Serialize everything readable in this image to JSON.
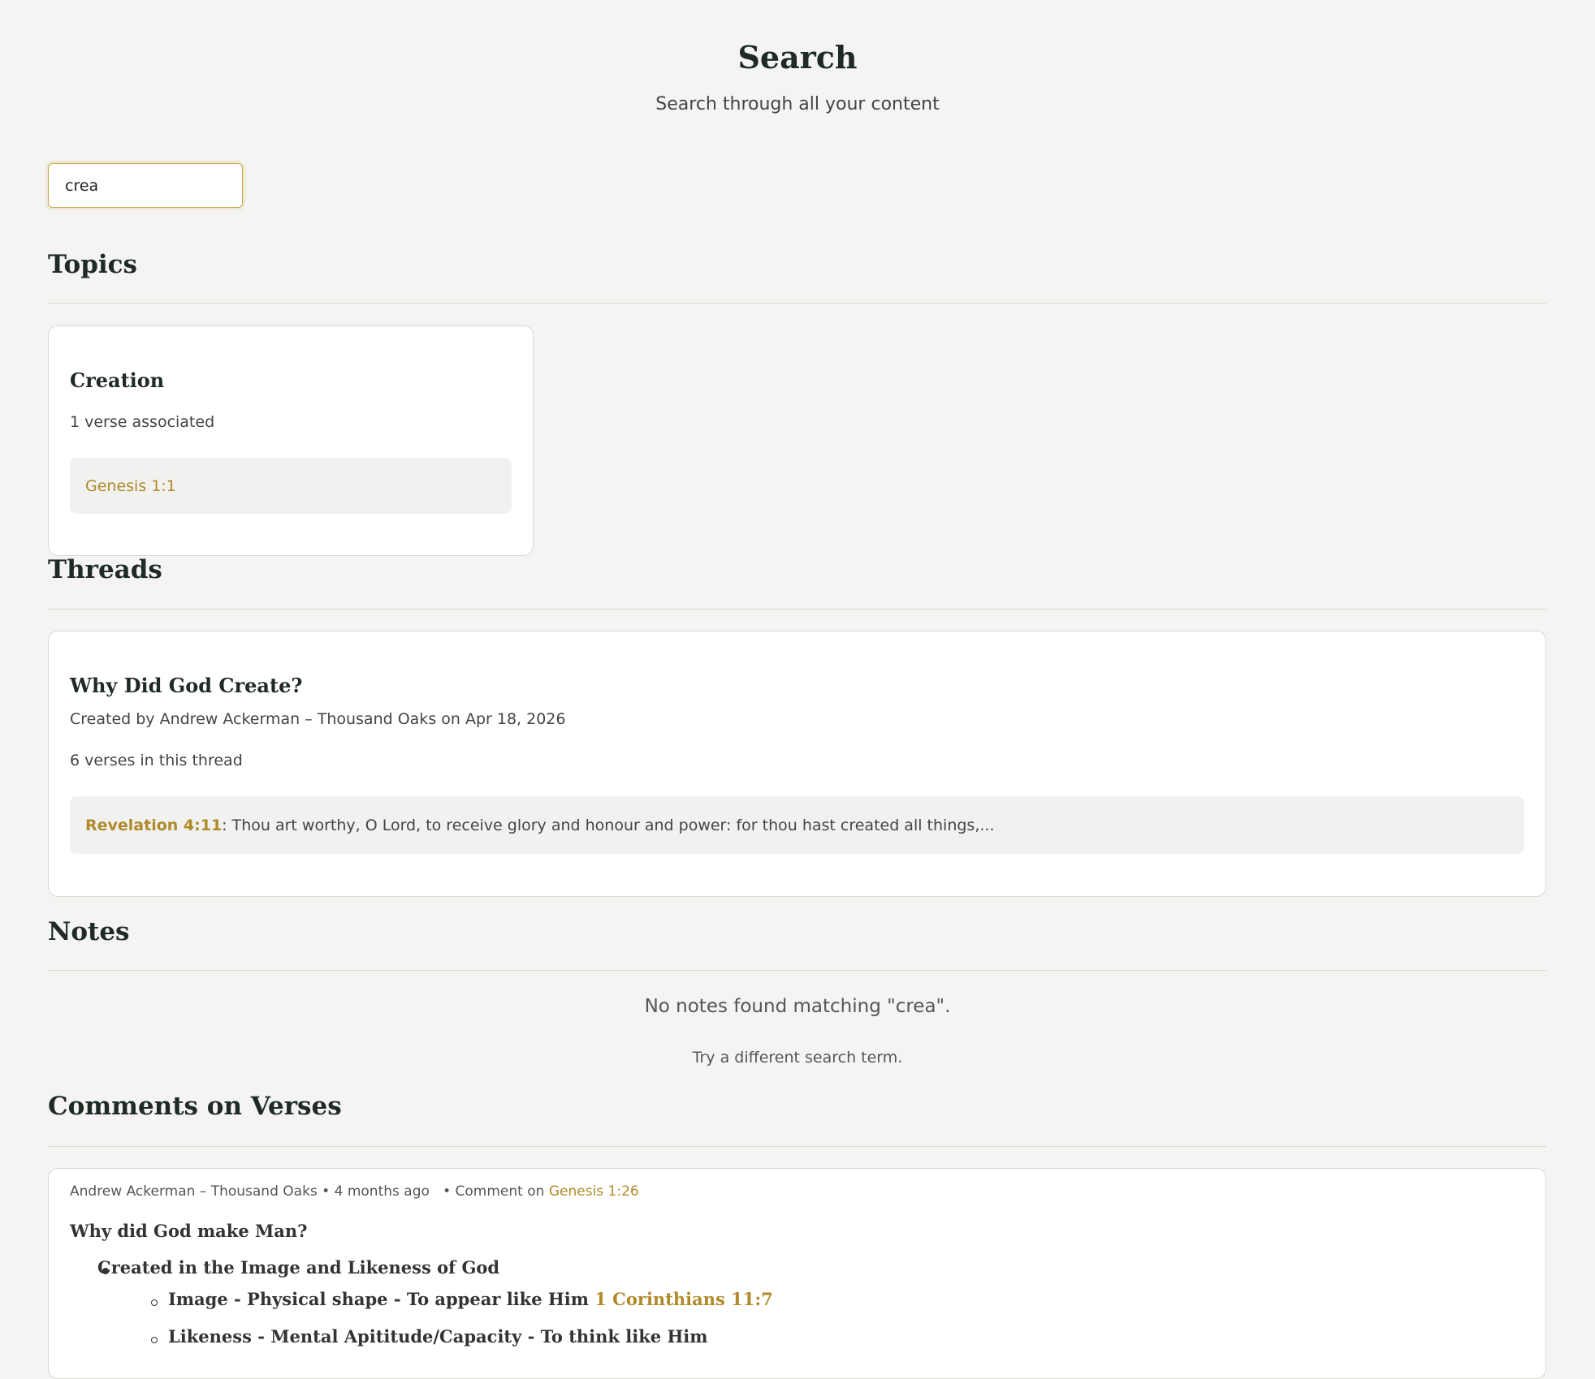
{
  "header": {
    "title": "Search",
    "subtitle": "Search through all your content"
  },
  "search": {
    "value": "crea",
    "placeholder": ""
  },
  "topics": {
    "section_title": "Topics",
    "items": [
      {
        "title": "Creation",
        "count_text": "1 verse associated",
        "verses": [
          "Genesis 1:1"
        ]
      }
    ]
  },
  "threads": {
    "section_title": "Threads",
    "items": [
      {
        "title": "Why Did God Create?",
        "created_by": "Created by Andrew Ackerman – Thousand Oaks on Apr 18, 2026",
        "count_text": "6 verses in this thread",
        "preview_ref": "Revelation 4:11",
        "preview_text": ": Thou art worthy, O Lord, to receive glory and honour and power: for thou hast created all things,..."
      }
    ]
  },
  "notes": {
    "section_title": "Notes",
    "empty_message": "No notes found matching \"crea\".",
    "empty_hint": "Try a different search term."
  },
  "comments": {
    "section_title": "Comments on Verses",
    "items": [
      {
        "author_meta": "Andrew Ackerman – Thousand Oaks • 4 months ago",
        "comment_on_label": "• Comment on",
        "verse_ref": "Genesis 1:26",
        "heading": "Why did God make Man?",
        "list": [
          {
            "text": "Created in the Image and Likeness of God",
            "sub": [
              {
                "text": "Image - Physical shape - To appear like Him",
                "ref": "1 Corinthians 11:7"
              },
              {
                "text": "Likeness - Mental Apititude/Capacity - To think like Him",
                "ref": ""
              }
            ]
          }
        ]
      }
    ]
  },
  "colors": {
    "background": "#f4f4f2",
    "accent": "#b08a2a",
    "heading": "#1f2a24"
  }
}
